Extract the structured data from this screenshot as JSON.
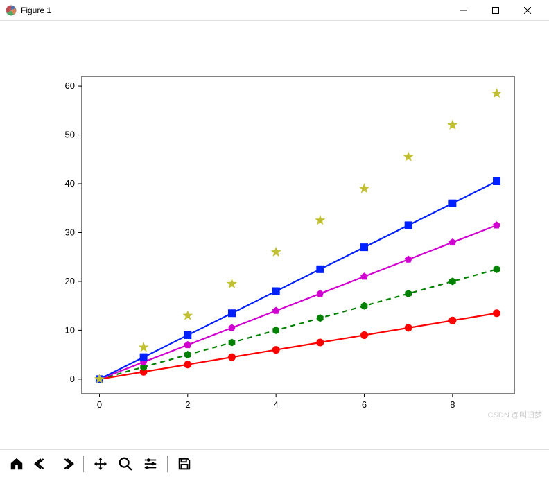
{
  "window": {
    "title": "Figure 1",
    "min_tooltip": "Minimize",
    "max_tooltip": "Maximize",
    "close_tooltip": "Close"
  },
  "toolbar": {
    "home": "Home",
    "back": "Back",
    "forward": "Forward",
    "pan": "Pan",
    "zoom": "Zoom",
    "configure": "Configure subplots",
    "save": "Save"
  },
  "watermark": "CSDN @叫旧梦",
  "chart_data": {
    "type": "line",
    "x": [
      0,
      1,
      2,
      3,
      4,
      5,
      6,
      7,
      8,
      9
    ],
    "xlim": [
      -0.4,
      9.4
    ],
    "ylim": [
      -3,
      62
    ],
    "xticks": [
      0,
      2,
      4,
      6,
      8
    ],
    "yticks": [
      0,
      10,
      20,
      30,
      40,
      50,
      60
    ],
    "xlabel": "",
    "ylabel": "",
    "title": "",
    "series": [
      {
        "name": "red",
        "color": "#ff0000",
        "marker": "circle",
        "style": "solid",
        "values": [
          0,
          1.5,
          3.0,
          4.5,
          6.0,
          7.5,
          9.0,
          10.5,
          12.0,
          13.5
        ]
      },
      {
        "name": "green",
        "color": "#008000",
        "marker": "hexagon",
        "style": "dashed",
        "values": [
          0,
          2.5,
          5.0,
          7.5,
          10.0,
          12.5,
          15.0,
          17.5,
          20.0,
          22.5
        ]
      },
      {
        "name": "magenta",
        "color": "#d000d0",
        "marker": "pentagon",
        "style": "solid",
        "values": [
          0,
          3.5,
          7.0,
          10.5,
          14.0,
          17.5,
          21.0,
          24.5,
          28.0,
          31.5
        ]
      },
      {
        "name": "blue",
        "color": "#0020ff",
        "marker": "square",
        "style": "solid",
        "values": [
          0,
          4.5,
          9.0,
          13.5,
          18.0,
          22.5,
          27.0,
          31.5,
          36.0,
          40.5
        ]
      },
      {
        "name": "yellow",
        "color": "#c0c030",
        "marker": "star",
        "style": "none",
        "values": [
          0,
          6.5,
          13.0,
          19.5,
          26.0,
          32.5,
          39.0,
          45.5,
          52.0,
          58.5
        ]
      }
    ]
  }
}
